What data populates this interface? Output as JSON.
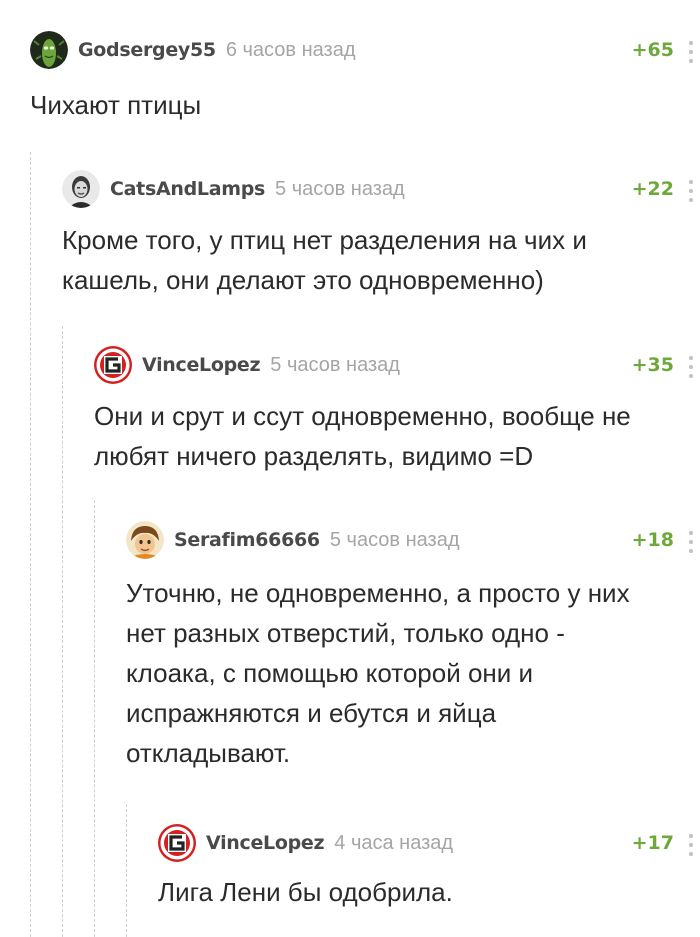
{
  "comments": [
    {
      "username": "Godsergey55",
      "time": "6 часов назад",
      "rating": "+65",
      "text": "Чихают птицы",
      "avatar": "pickle-rick-avatar"
    },
    {
      "username": "CatsAndLamps",
      "time": "5 часов назад",
      "rating": "+22",
      "text": "Кроме того, у птиц нет разделения на чих и кашель, они делают это одновременно)",
      "avatar": "portrait-avatar"
    },
    {
      "username": "VinceLopez",
      "time": "5 часов назад",
      "rating": "+35",
      "text": "Они и срут и ссут одновременно, вообще не любят ничего разделять, видимо =D",
      "avatar": "g-logo-avatar"
    },
    {
      "username": "Serafim66666",
      "time": "5 часов назад",
      "rating": "+18",
      "text": "Уточню, не одновременно, а просто у них нет разных отверстий, только одно - клоака, с помощью которой они и испражняются и ебутся и яйца откладывают.",
      "avatar": "cartoon-character-avatar"
    },
    {
      "username": "VinceLopez",
      "time": "4 часа назад",
      "rating": "+17",
      "text": "Лига Лени бы одобрила.",
      "avatar": "g-logo-avatar"
    }
  ],
  "colors": {
    "rating": "#6fa83a",
    "username": "#4a4a4a",
    "timestamp": "#a5a5a5",
    "text": "#2b2b2b",
    "thread_line": "#cfcfcf"
  }
}
